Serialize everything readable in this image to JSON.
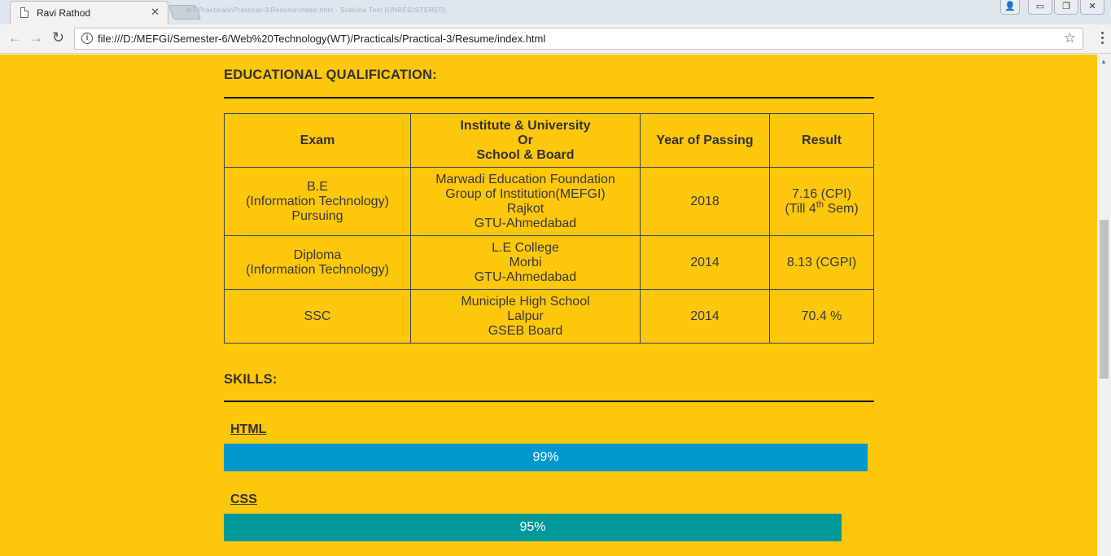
{
  "browser": {
    "tab_title": "Ravi Rathod",
    "tab_close": "✕",
    "blurred_tab_text": "WT\\Practicals\\Practical-3\\Resume\\index.html - Sublime Text (UNREGISTERED)",
    "url": "file:///D:/MEFGI/Semester-6/Web%20Technology(WT)/Practicals/Practical-3/Resume/index.html",
    "window_buttons": [
      "▭",
      "❐",
      "✕"
    ]
  },
  "education": {
    "heading": "EDUCATIONAL QUALIFICATION:",
    "headers": {
      "exam": "Exam",
      "institute_line1": "Institute & University",
      "institute_line2": "Or",
      "institute_line3": "School & Board",
      "year": "Year of Passing",
      "result": "Result"
    },
    "rows": [
      {
        "exam": [
          "B.E",
          "(Information Technology)",
          "Pursuing"
        ],
        "institute": [
          "Marwadi Education Foundation",
          "Group of Institution(MEFGI)",
          "Rajkot",
          "GTU-Ahmedabad"
        ],
        "year": "2018",
        "result_line1": "7.16 (CPI)",
        "result_line2_pre": "(Till 4",
        "result_line2_sup": "th",
        "result_line2_post": " Sem)"
      },
      {
        "exam": [
          "Diploma",
          "(Information Technology)"
        ],
        "institute": [
          "L.E College",
          "Morbi",
          "GTU-Ahmedabad"
        ],
        "year": "2014",
        "result": "8.13 (CGPI)"
      },
      {
        "exam": [
          "SSC"
        ],
        "institute": [
          "Municiple High School",
          "Lalpur",
          "GSEB Board"
        ],
        "year": "2014",
        "result": "70.4 %"
      }
    ]
  },
  "skills": {
    "heading": "SKILLS:",
    "items": [
      {
        "name": "HTML",
        "percent_label": "99%",
        "percent": 99,
        "color": "#0198cd"
      },
      {
        "name": "CSS",
        "percent_label": "95%",
        "percent": 95,
        "color": "#029899"
      }
    ]
  },
  "colors": {
    "page_background": "#fdc70c"
  }
}
